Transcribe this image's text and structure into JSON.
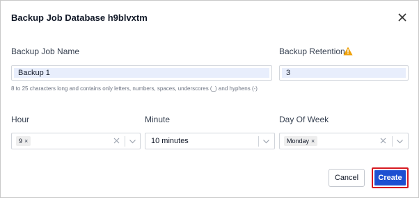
{
  "dialog": {
    "title": "Backup Job Database h9blvxtm",
    "close_icon": "close-icon"
  },
  "form": {
    "job_name": {
      "label": "Backup Job Name",
      "value": "Backup 1",
      "hint": "8 to 25 characters long and contains only letters, numbers, spaces, underscores (_) and hyphens (-)"
    },
    "retention": {
      "label": "Backup Retention",
      "value": "3",
      "warning_icon": "warning-icon",
      "warning_color": "#f0a20b"
    },
    "hour": {
      "label": "Hour",
      "chip": "9",
      "chip_remove": "×"
    },
    "minute": {
      "label": "Minute",
      "value": "10 minutes"
    },
    "day_of_week": {
      "label": "Day Of Week",
      "chip": "Monday",
      "chip_remove": "×"
    }
  },
  "actions": {
    "cancel_label": "Cancel",
    "create_label": "Create",
    "create_color": "#1d4fd1",
    "highlight_color": "#d71920"
  }
}
